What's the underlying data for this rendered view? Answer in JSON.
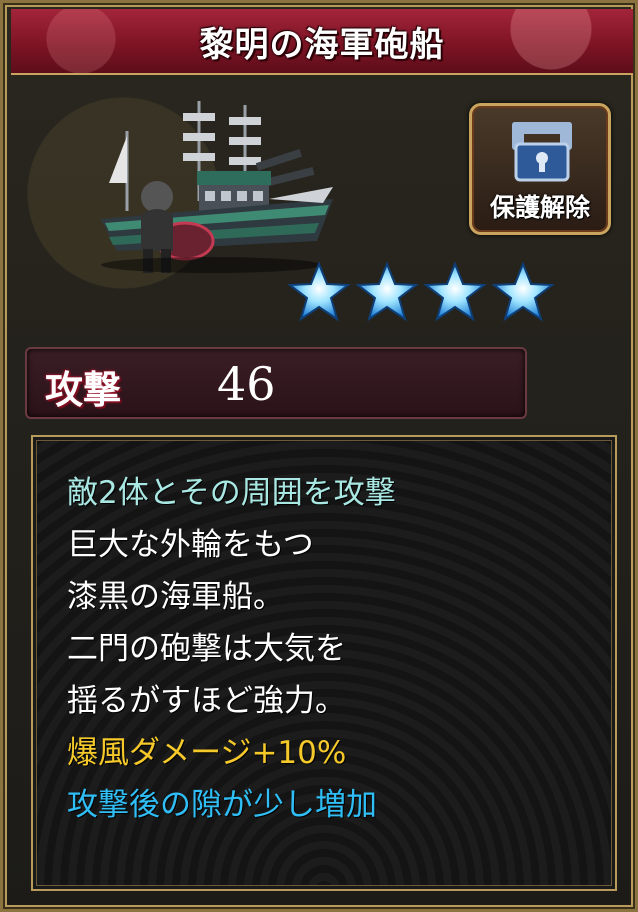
{
  "card": {
    "title": "黎明の海軍砲船",
    "protect_button_label": "保護解除",
    "rarity_stars": 4,
    "stat": {
      "label": "攻撃",
      "value": "46"
    },
    "description": [
      {
        "text": "敵2体とその周囲を攻撃",
        "color": "#a9e7e3"
      },
      {
        "text": "巨大な外輪をもつ",
        "color": "#ffffff"
      },
      {
        "text": "漆黒の海軍船。",
        "color": "#ffffff"
      },
      {
        "text": "二門の砲撃は大気を",
        "color": "#ffffff"
      },
      {
        "text": "揺るがすほど強力。",
        "color": "#ffffff"
      },
      {
        "text": "爆風ダメージ+10%",
        "color": "#f5c92a"
      },
      {
        "text": "攻撃後の隙が少し増加",
        "color": "#2fbef5"
      }
    ]
  },
  "icons": {
    "unit": "steam-warship-sprite",
    "protect": "lock-icon",
    "star": "star-icon"
  },
  "colors": {
    "title_bar": "#7e1425",
    "frame_gold": "#b89a5a",
    "star_blue": "#7fd8ff"
  }
}
